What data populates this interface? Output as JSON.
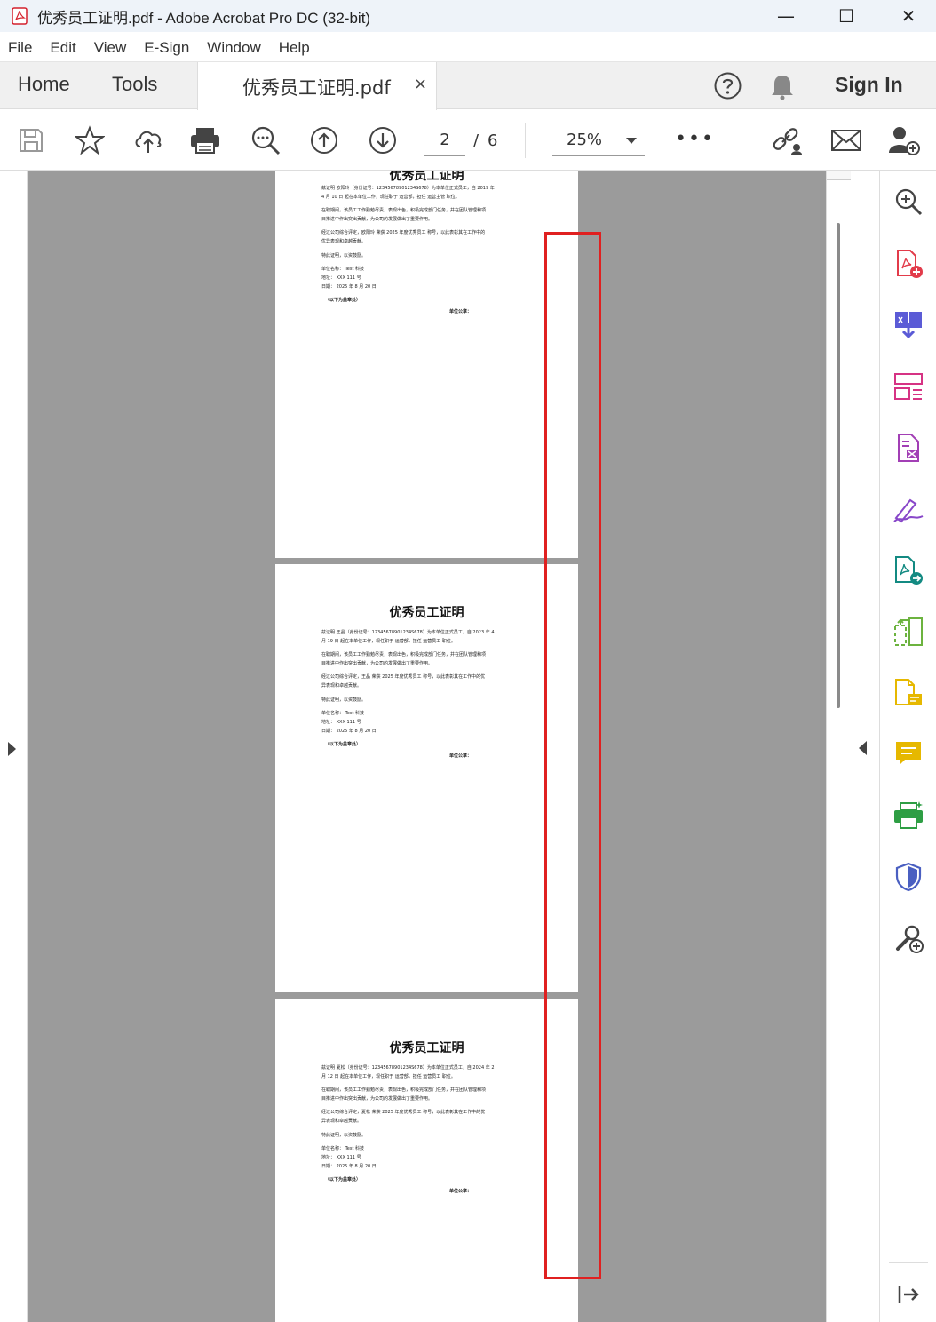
{
  "window": {
    "title": "优秀员工证明.pdf - Adobe Acrobat Pro DC (32-bit)",
    "minimize": "—",
    "maximize": "☐",
    "close": "✕"
  },
  "menu": [
    "File",
    "Edit",
    "View",
    "E-Sign",
    "Window",
    "Help"
  ],
  "tabs": {
    "home": "Home",
    "tools": "Tools",
    "document": "优秀员工证明.pdf",
    "close": "×"
  },
  "header": {
    "sign_in": "Sign In"
  },
  "toolbar": {
    "current_page": "2",
    "separator": "/",
    "total_pages": "6",
    "zoom": "25%",
    "more": "•••"
  },
  "pages": [
    {
      "title": "优秀员工证明",
      "lines": [
        "兹证明 欧阳玲（身份证号：12345678901234S678）为本单位正式员工，自 2019 年",
        "4 月 10 日 起在本单位工作，现任职于 运营部，担任 运营主管 职位。",
        "在职期间，该员工工作勤勉尽责，表现出色，积极完成部门任务，并在团队管理和项",
        "目推进中作出突出贡献，为公司的发展做出了重要作用。",
        "经过公司综合评定，欧阳玲 荣获 2025 年度优秀员工 称号，以此表彰其在工作中的",
        "优异表现和卓越贡献。",
        "特此证明，以资鼓励。",
        "单位名称： Test 科技",
        "地址： XXX 111 号",
        "日期： 2025 年 8 月 20 日",
        "（以下为盖章处）"
      ],
      "seal": "单位公章："
    },
    {
      "title": "优秀员工证明",
      "lines": [
        "兹证明 王晶（身份证号：12345678901234S678）为本单位正式员工，自 2023 年 4",
        "月 19 日 起在本单位工作，现任职于 运营部，担任 运营员工 职位。",
        "在职期间，该员工工作勤勉尽责，表现出色，积极完成部门任务，并在团队管理和项",
        "目推进中作出突出贡献，为公司的发展做出了重要作用。",
        "经过公司综合评定，王晶 荣获 2025 年度优秀员工 称号，以此表彰其在工作中的优",
        "异表现和卓越贡献。",
        "特此证明，以资鼓励。",
        "单位名称： Test 科技",
        "地址： XXX 111 号",
        "日期： 2025 年 8 月 20 日",
        "（以下为盖章处）"
      ],
      "seal": "单位公章："
    },
    {
      "title": "优秀员工证明",
      "lines": [
        "兹证明 夏松（身份证号：12345678901234S678）为本单位正式员工，自 2024 年 2",
        "月 12 日 起在本单位工作，现任职于 运营部，担任 运营员工 职位。",
        "在职期间，该员工工作勤勉尽责，表现出色，积极完成部门任务，并在团队管理和项",
        "目推进中作出突出贡献，为公司的发展做出了重要作用。",
        "经过公司综合评定，夏松 荣获 2025 年度优秀员工 称号，以此表彰其在工作中的优",
        "异表现和卓越贡献。",
        "特此证明，以资鼓励。",
        "单位名称： Test 科技",
        "地址： XXX 111 号",
        "日期： 2025 年 8 月 20 日",
        "（以下为盖章处）"
      ],
      "seal": "单位公章："
    }
  ],
  "rail_icons": [
    "zoom-search-icon",
    "create-pdf-icon",
    "combine-files-icon",
    "organize-pages-icon",
    "edit-pdf-icon",
    "fill-sign-icon",
    "export-pdf-icon",
    "compress-icon",
    "comment-doc-icon",
    "comment-icon",
    "print-production-icon",
    "protect-icon",
    "more-tools-icon"
  ],
  "colors": {
    "highlight": "#e02020",
    "canvas": "#9b9b9b",
    "pdf_red": "#d4212d"
  }
}
